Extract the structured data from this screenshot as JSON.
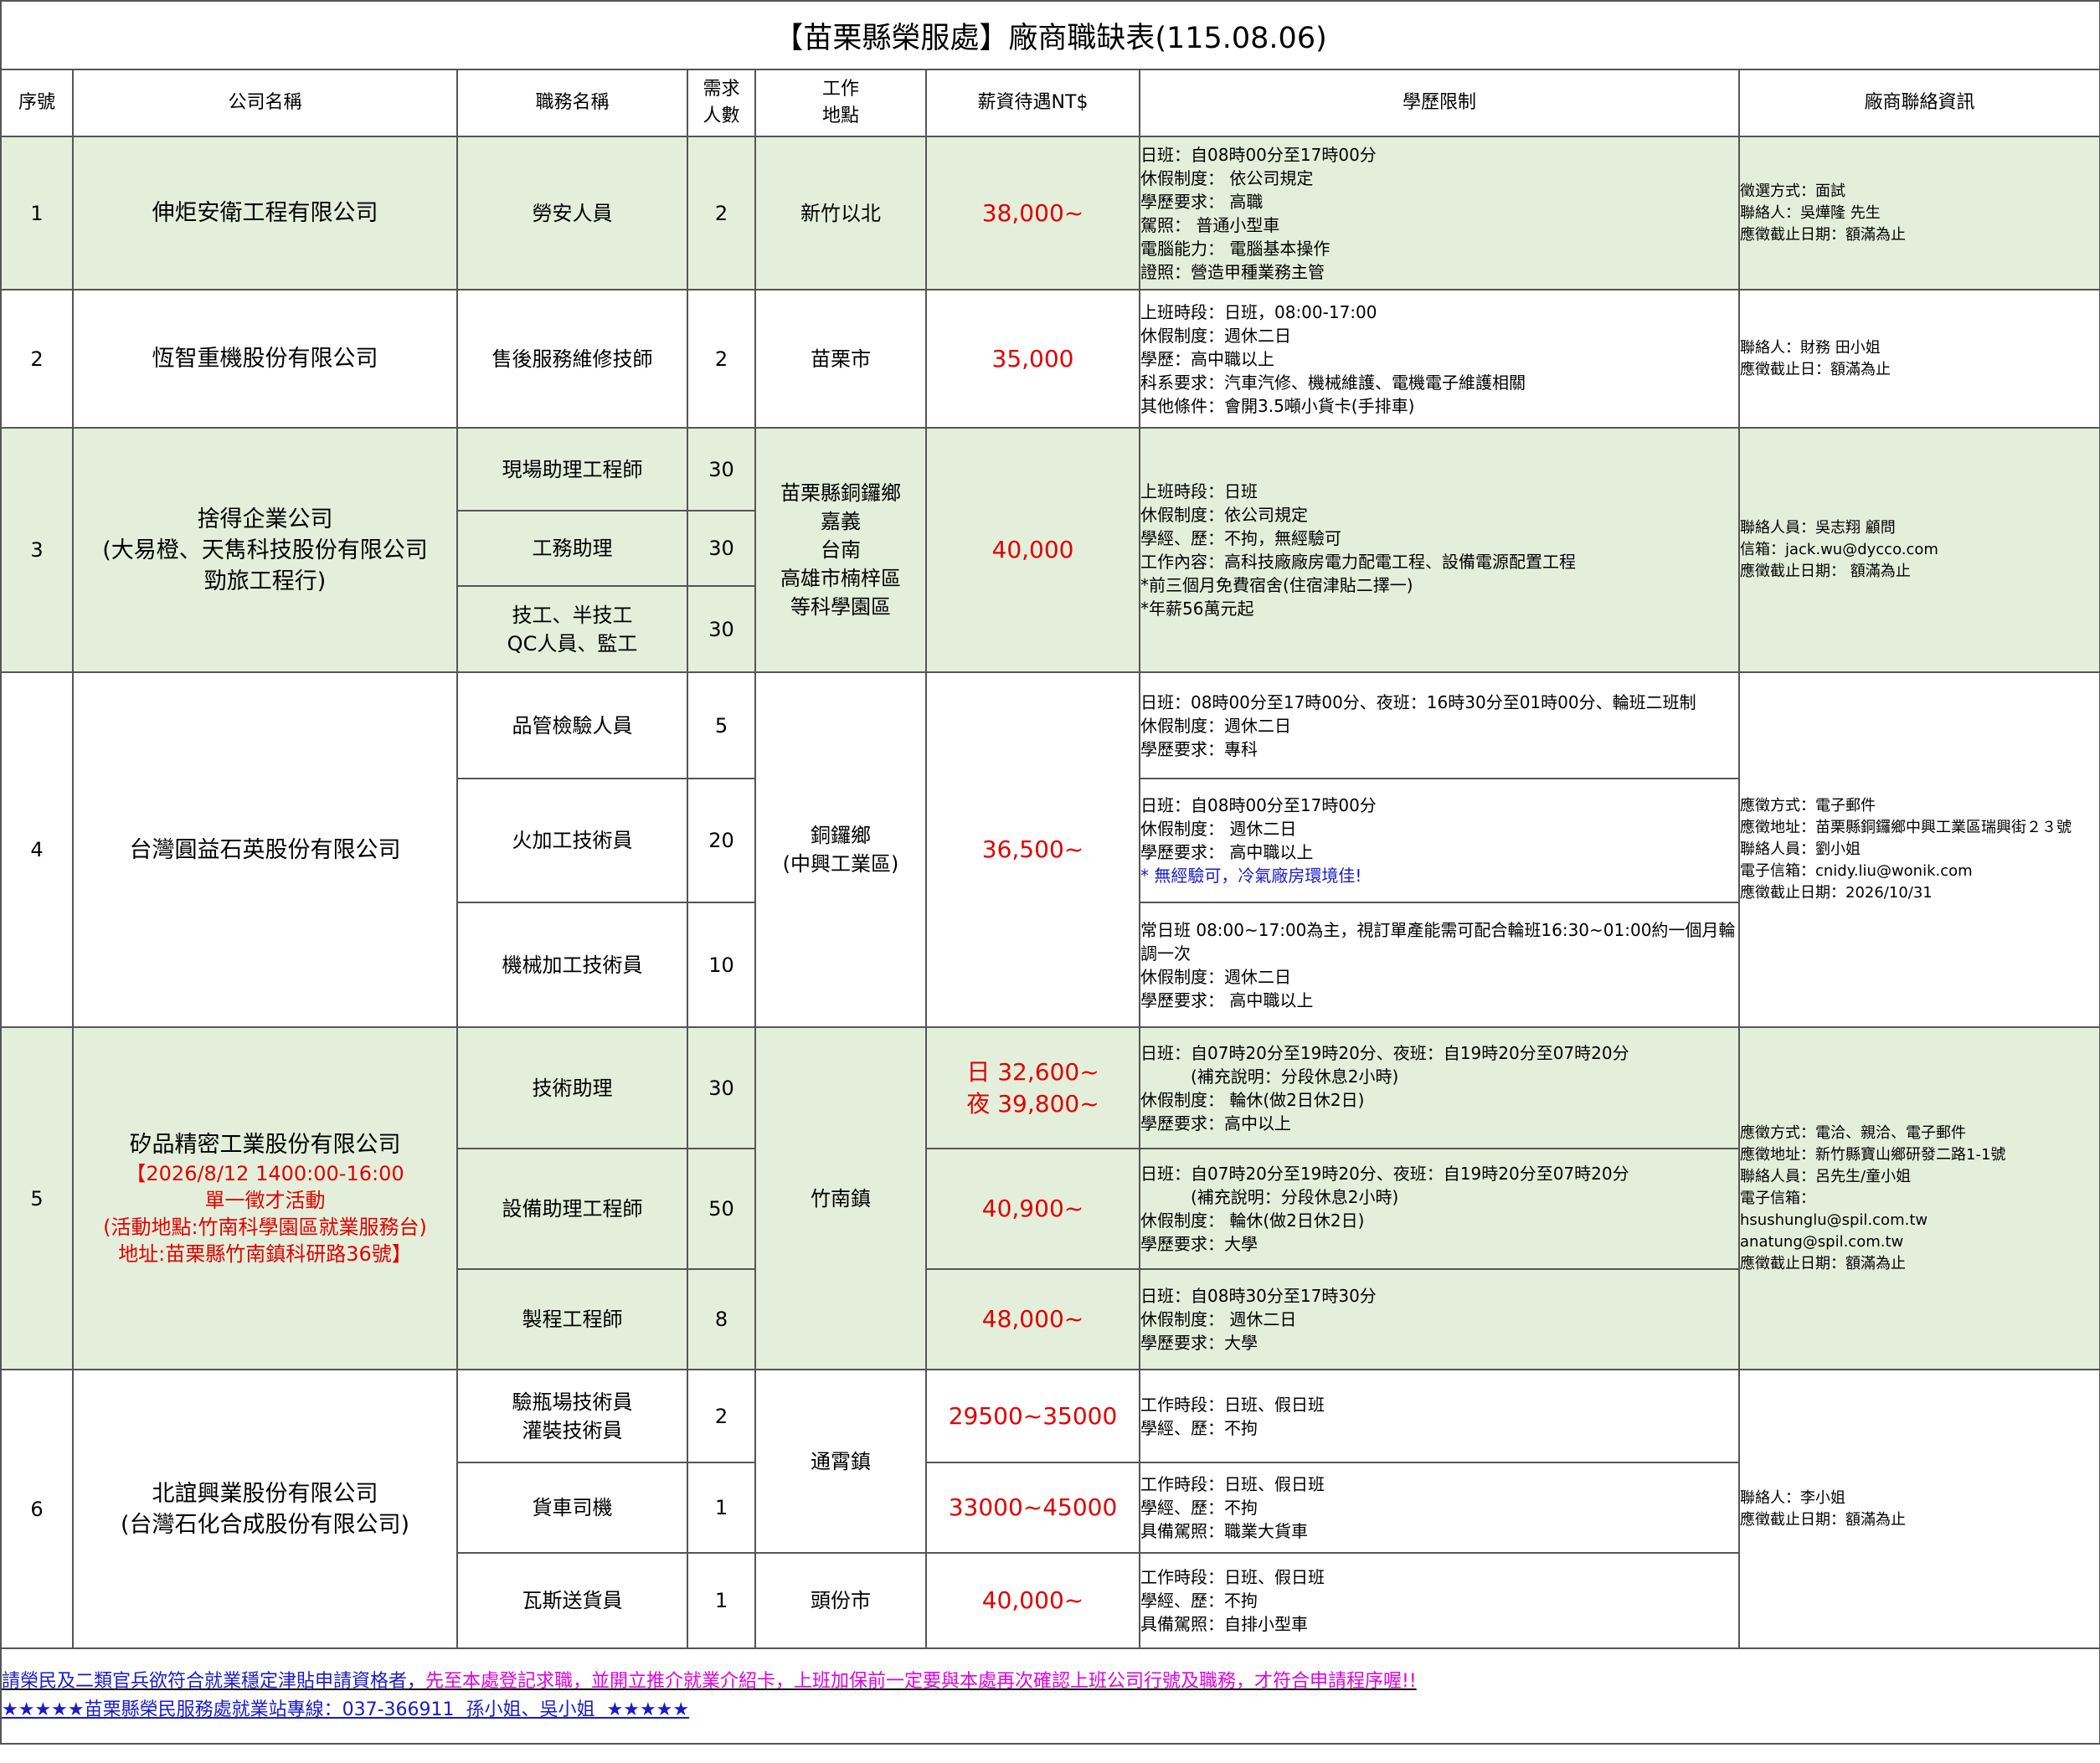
{
  "title": "【苗栗縣榮服處】廠商職缺表(115.08.06)",
  "headers": {
    "seq": "序號",
    "company": "公司名稱",
    "job": "職務名稱",
    "count_1": "需求",
    "count_2": "人數",
    "location_1": "工作",
    "location_2": "地點",
    "salary": "薪資待遇NT$",
    "education": "學歷限制",
    "contact": "廠商聯絡資訊"
  },
  "rows": [
    {
      "seq": "1",
      "company": "伸炬安衛工程有限公司",
      "jobs": [
        {
          "name": "勞安人員",
          "count": "2"
        }
      ],
      "location": "新竹以北",
      "salary": "38,000~",
      "education": [
        "日班：自08時00分至17時00分",
        "休假制度： 依公司規定",
        "學歷要求： 高職",
        "駕照： 普通小型車",
        "電腦能力： 電腦基本操作",
        "證照：營造甲種業務主管"
      ],
      "contact": [
        "徵選方式：面試",
        "聯絡人：吳燁隆 先生",
        "應徵截止日期：額滿為止"
      ]
    },
    {
      "seq": "2",
      "company": "恆智重機股份有限公司",
      "jobs": [
        {
          "name": "售後服務維修技師",
          "count": "2"
        }
      ],
      "location": "苗栗市",
      "salary": "35,000",
      "education": [
        "上班時段：日班，08:00-17:00",
        "休假制度：週休二日",
        "學歷：高中職以上",
        "科系要求：汽車汽修、機械維護、電機電子維護相關",
        "其他條件：會開3.5噸小貨卡(手排車)"
      ],
      "contact": [
        "聯絡人：財務 田小姐",
        "應徵截止日：額滿為止"
      ]
    },
    {
      "seq": "3",
      "company": [
        "捨得企業公司",
        "(大易橙、天雋科技股份有限公司",
        "勁旅工程行)"
      ],
      "jobs": [
        {
          "name": [
            "現場助理工程師"
          ],
          "count": "30"
        },
        {
          "name": [
            "工務助理"
          ],
          "count": "30"
        },
        {
          "name": [
            "技工、半技工",
            "QC人員、監工"
          ],
          "count": "30"
        }
      ],
      "location": [
        "苗栗縣銅鑼鄉",
        "嘉義",
        "台南",
        "高雄市楠梓區",
        "等科學園區"
      ],
      "salary": "40,000",
      "education": [
        "上班時段：日班",
        "休假制度：依公司規定",
        "學經、歷：不拘，無經驗可",
        "工作內容：高科技廠廠房電力配電工程、設備電源配置工程",
        "*前三個月免費宿舍(住宿津貼二擇一)",
        "*年薪56萬元起"
      ],
      "contact": [
        "聯絡人員：吳志翔 顧問",
        "信箱：jack.wu@dycco.com",
        "應徵截止日期： 額滿為止"
      ]
    },
    {
      "seq": "4",
      "company": "台灣圓益石英股份有限公司",
      "jobs": [
        {
          "name": "品管檢驗人員",
          "count": "5",
          "education": [
            "日班：08時00分至17時00分、夜班：16時30分至01時00分、輪班二班制",
            "休假制度：週休二日",
            "學歷要求：專科"
          ]
        },
        {
          "name": "火加工技術員",
          "count": "20",
          "education": [
            "日班：自08時00分至17時00分",
            "休假制度： 週休二日",
            "學歷要求： 高中職以上"
          ],
          "note": "* 無經驗可，冷氣廠房環境佳!"
        },
        {
          "name": "機械加工技術員",
          "count": "10",
          "education": [
            "常日班 08:00~17:00為主，視訂單產能需可配合輪班16:30~01:00約一個月輪調一次",
            "休假制度：週休二日",
            "學歷要求： 高中職以上"
          ]
        }
      ],
      "location": [
        "銅鑼鄉",
        "(中興工業區)"
      ],
      "salary": "36,500~",
      "contact": [
        "應徵方式：電子郵件",
        "應徵地址：苗栗縣銅鑼鄉中興工業區瑞興街２３號",
        "聯絡人員：劉小姐",
        "電子信箱：cnidy.liu@wonik.com",
        "應徵截止日期：2026/10/31"
      ]
    },
    {
      "seq": "5",
      "company": "矽品精密工業股份有限公司",
      "event": [
        "【2026/8/12 1400:00-16:00",
        "單一徵才活動",
        "(活動地點:竹南科學園區就業服務台)",
        "地址:苗栗縣竹南鎮科研路36號】"
      ],
      "jobs": [
        {
          "name": "技術助理",
          "count": "30",
          "salary": [
            "日 32,600~",
            "夜 39,800~"
          ],
          "education": [
            "日班：自07時20分至19時20分、夜班：自19時20分至07時20分",
            "　　　(補充說明：分段休息2小時)",
            "休假制度： 輪休(做2日休2日)",
            "學歷要求：高中以上"
          ]
        },
        {
          "name": "設備助理工程師",
          "count": "50",
          "salary": [
            "40,900~"
          ],
          "education": [
            "日班：自07時20分至19時20分、夜班：自19時20分至07時20分",
            "　　　(補充說明：分段休息2小時)",
            "休假制度： 輪休(做2日休2日)",
            "學歷要求：大學"
          ]
        },
        {
          "name": "製程工程師",
          "count": "8",
          "salary": [
            "48,000~"
          ],
          "education": [
            "日班：自08時30分至17時30分",
            "休假制度： 週休二日",
            "學歷要求：大學"
          ]
        }
      ],
      "location": "竹南鎮",
      "contact": [
        "應徵方式：電洽、親洽、電子郵件",
        "應徵地址：新竹縣寶山鄉研發二路1-1號",
        "聯絡人員：呂先生/童小姐",
        "電子信箱：",
        "hsushunglu@spil.com.tw",
        "anatung@spil.com.tw",
        "應徵截止日期：額滿為止"
      ]
    },
    {
      "seq": "6",
      "company": [
        "北誼興業股份有限公司",
        "(台灣石化合成股份有限公司)"
      ],
      "jobs": [
        {
          "name": [
            "驗瓶場技術員",
            "灌裝技術員"
          ],
          "count": "2",
          "salary": "29500~35000",
          "education": [
            "工作時段：日班、假日班",
            "學經、歷：不拘"
          ]
        },
        {
          "name": [
            "貨車司機"
          ],
          "count": "1",
          "salary": "33000~45000",
          "education": [
            "工作時段：日班、假日班",
            "學經、歷：不拘",
            "具備駕照：職業大貨車"
          ]
        },
        {
          "name": [
            "瓦斯送貨員"
          ],
          "count": "1",
          "salary": "40,000~",
          "location": "頭份市",
          "education": [
            "工作時段：日班、假日班",
            "學經、歷：不拘",
            "具備駕照：自排小型車"
          ]
        }
      ],
      "location": "通霄鎮",
      "contact": [
        "聯絡人：李小姐",
        "應徵截止日期：額滿為止"
      ]
    }
  ],
  "footer": {
    "line1_part1": "請榮民及二類官兵欲符合就業穩定津貼申請資格者，",
    "line1_part2": "先至本處登記求職，並開立推介就業介紹卡，上班加保前一定要與本處再次確認上班公司行號及職務，才符合申請程序喔!!",
    "line2": "★★★★★苗栗縣榮民服務處就業站專線：037-366911  孫小姐、吳小姐  ★★★★★"
  }
}
